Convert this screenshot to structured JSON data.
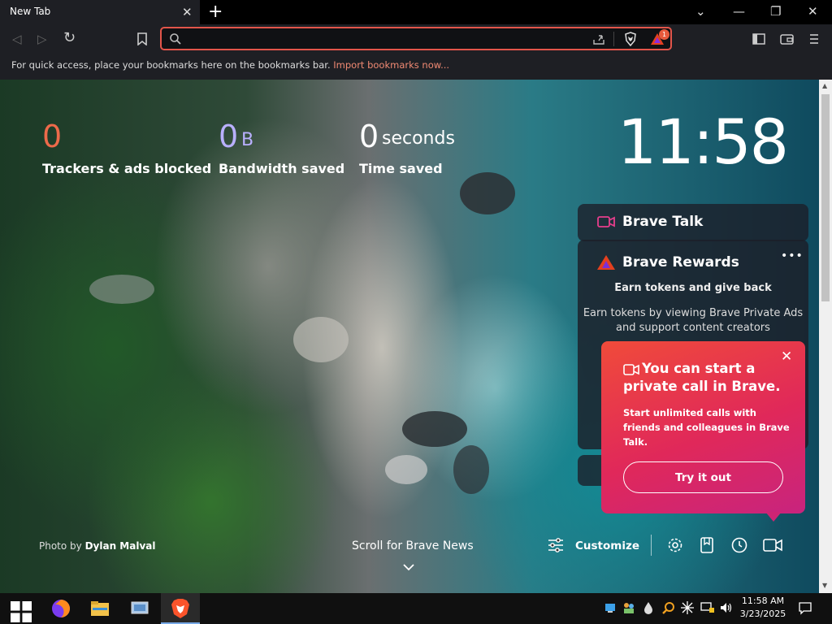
{
  "tab": {
    "title": "New Tab",
    "close": "✕"
  },
  "window": {
    "new_tab": "+",
    "dropdown": "⌄",
    "minimize": "—",
    "restore": "❐",
    "close": "✕"
  },
  "toolbar": {
    "back": "◁",
    "forward": "▷",
    "reload": "↻",
    "url_value": "",
    "url_placeholder": "",
    "rewards_badge": "1"
  },
  "bookmarks_bar": {
    "text": "For quick access, place your bookmarks here on the bookmarks bar.",
    "link": "Import bookmarks now..."
  },
  "stats": {
    "trackers": {
      "value": "0",
      "label": "Trackers & ads blocked",
      "color": "#ee6a4a"
    },
    "bandwidth": {
      "value": "0",
      "unit": "B",
      "label": "Bandwidth saved",
      "color": "#b9b0ff"
    },
    "time": {
      "value": "0",
      "unit": "seconds",
      "label": "Time saved"
    }
  },
  "clock": "11:58",
  "brave_talk": {
    "title": "Brave Talk"
  },
  "brave_rewards": {
    "title": "Brave Rewards",
    "menu": "•••",
    "subtitle": "Earn tokens and give back",
    "body": "Earn tokens by viewing Brave Private Ads and support content creators"
  },
  "popup": {
    "title": "You can start a private call in Brave.",
    "body": "Start unlimited calls with friends and colleagues in Brave Talk.",
    "button": "Try it out",
    "close": "✕"
  },
  "footer": {
    "photo_prefix": "Photo by",
    "photo_author": "Dylan Malval",
    "scroll_news": "Scroll for Brave News",
    "customize": "Customize"
  },
  "taskbar": {
    "time": "11:58 AM",
    "date": "3/23/2025"
  }
}
